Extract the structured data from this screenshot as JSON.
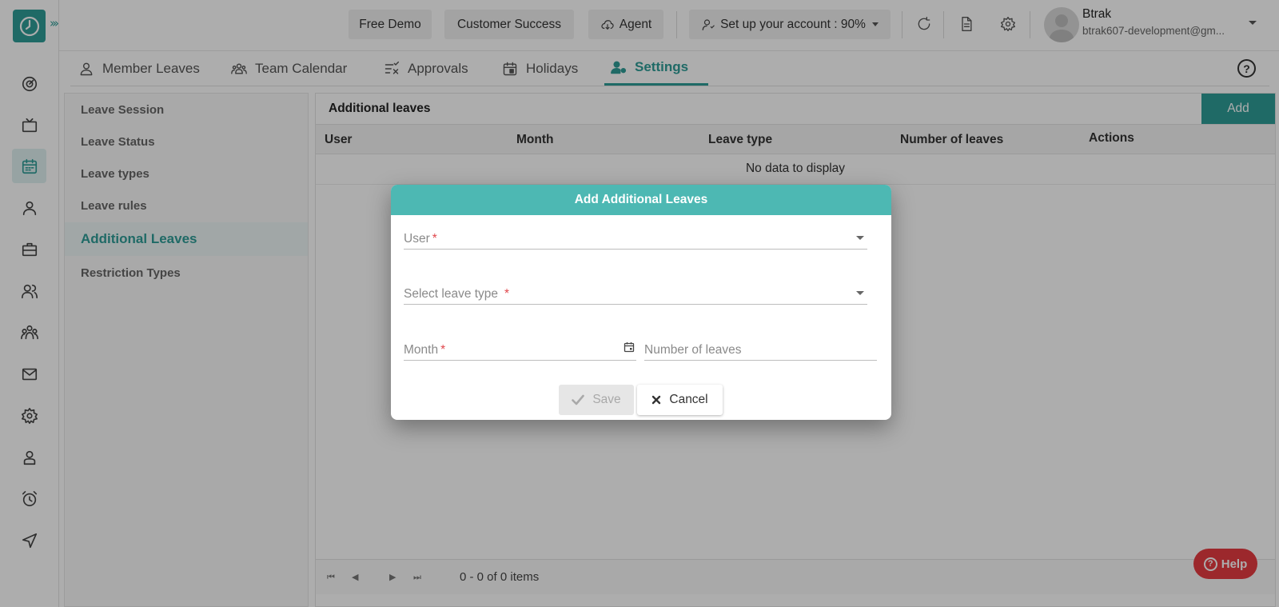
{
  "topbar": {
    "free_demo": "Free Demo",
    "customer_success": "Customer Success",
    "agent": "Agent",
    "setup": "Set up your account : 90%",
    "user_name": "Btrak",
    "user_email": "btrak607-development@gm..."
  },
  "tabs": [
    {
      "label": "Member Leaves",
      "icon": "person-icon"
    },
    {
      "label": "Team Calendar",
      "icon": "team-icon"
    },
    {
      "label": "Approvals",
      "icon": "approvals-icon"
    },
    {
      "label": "Holidays",
      "icon": "calendar-icon"
    },
    {
      "label": "Settings",
      "icon": "user-settings-icon"
    }
  ],
  "menu": {
    "items": [
      "Leave Session",
      "Leave Status",
      "Leave types",
      "Leave rules",
      "Additional Leaves",
      "Restriction Types"
    ],
    "active": "Additional Leaves"
  },
  "panel": {
    "title": "Additional leaves",
    "add_label": "Add",
    "columns": [
      "User",
      "Month",
      "Leave type",
      "Number of leaves",
      "Actions"
    ],
    "empty_text": "No data to display",
    "pager_info": "0 - 0 of 0 items"
  },
  "modal": {
    "title": "Add Additional Leaves",
    "user_label": "User",
    "leave_type_label": "Select leave type",
    "month_label": "Month",
    "number_label": "Number of leaves",
    "required_mark": "*",
    "save_label": "Save",
    "cancel_label": "Cancel"
  },
  "help": {
    "label": "Help"
  },
  "colors": {
    "accent": "#2f9c97",
    "modal_header": "#4db8b3",
    "help": "#e63b41"
  }
}
